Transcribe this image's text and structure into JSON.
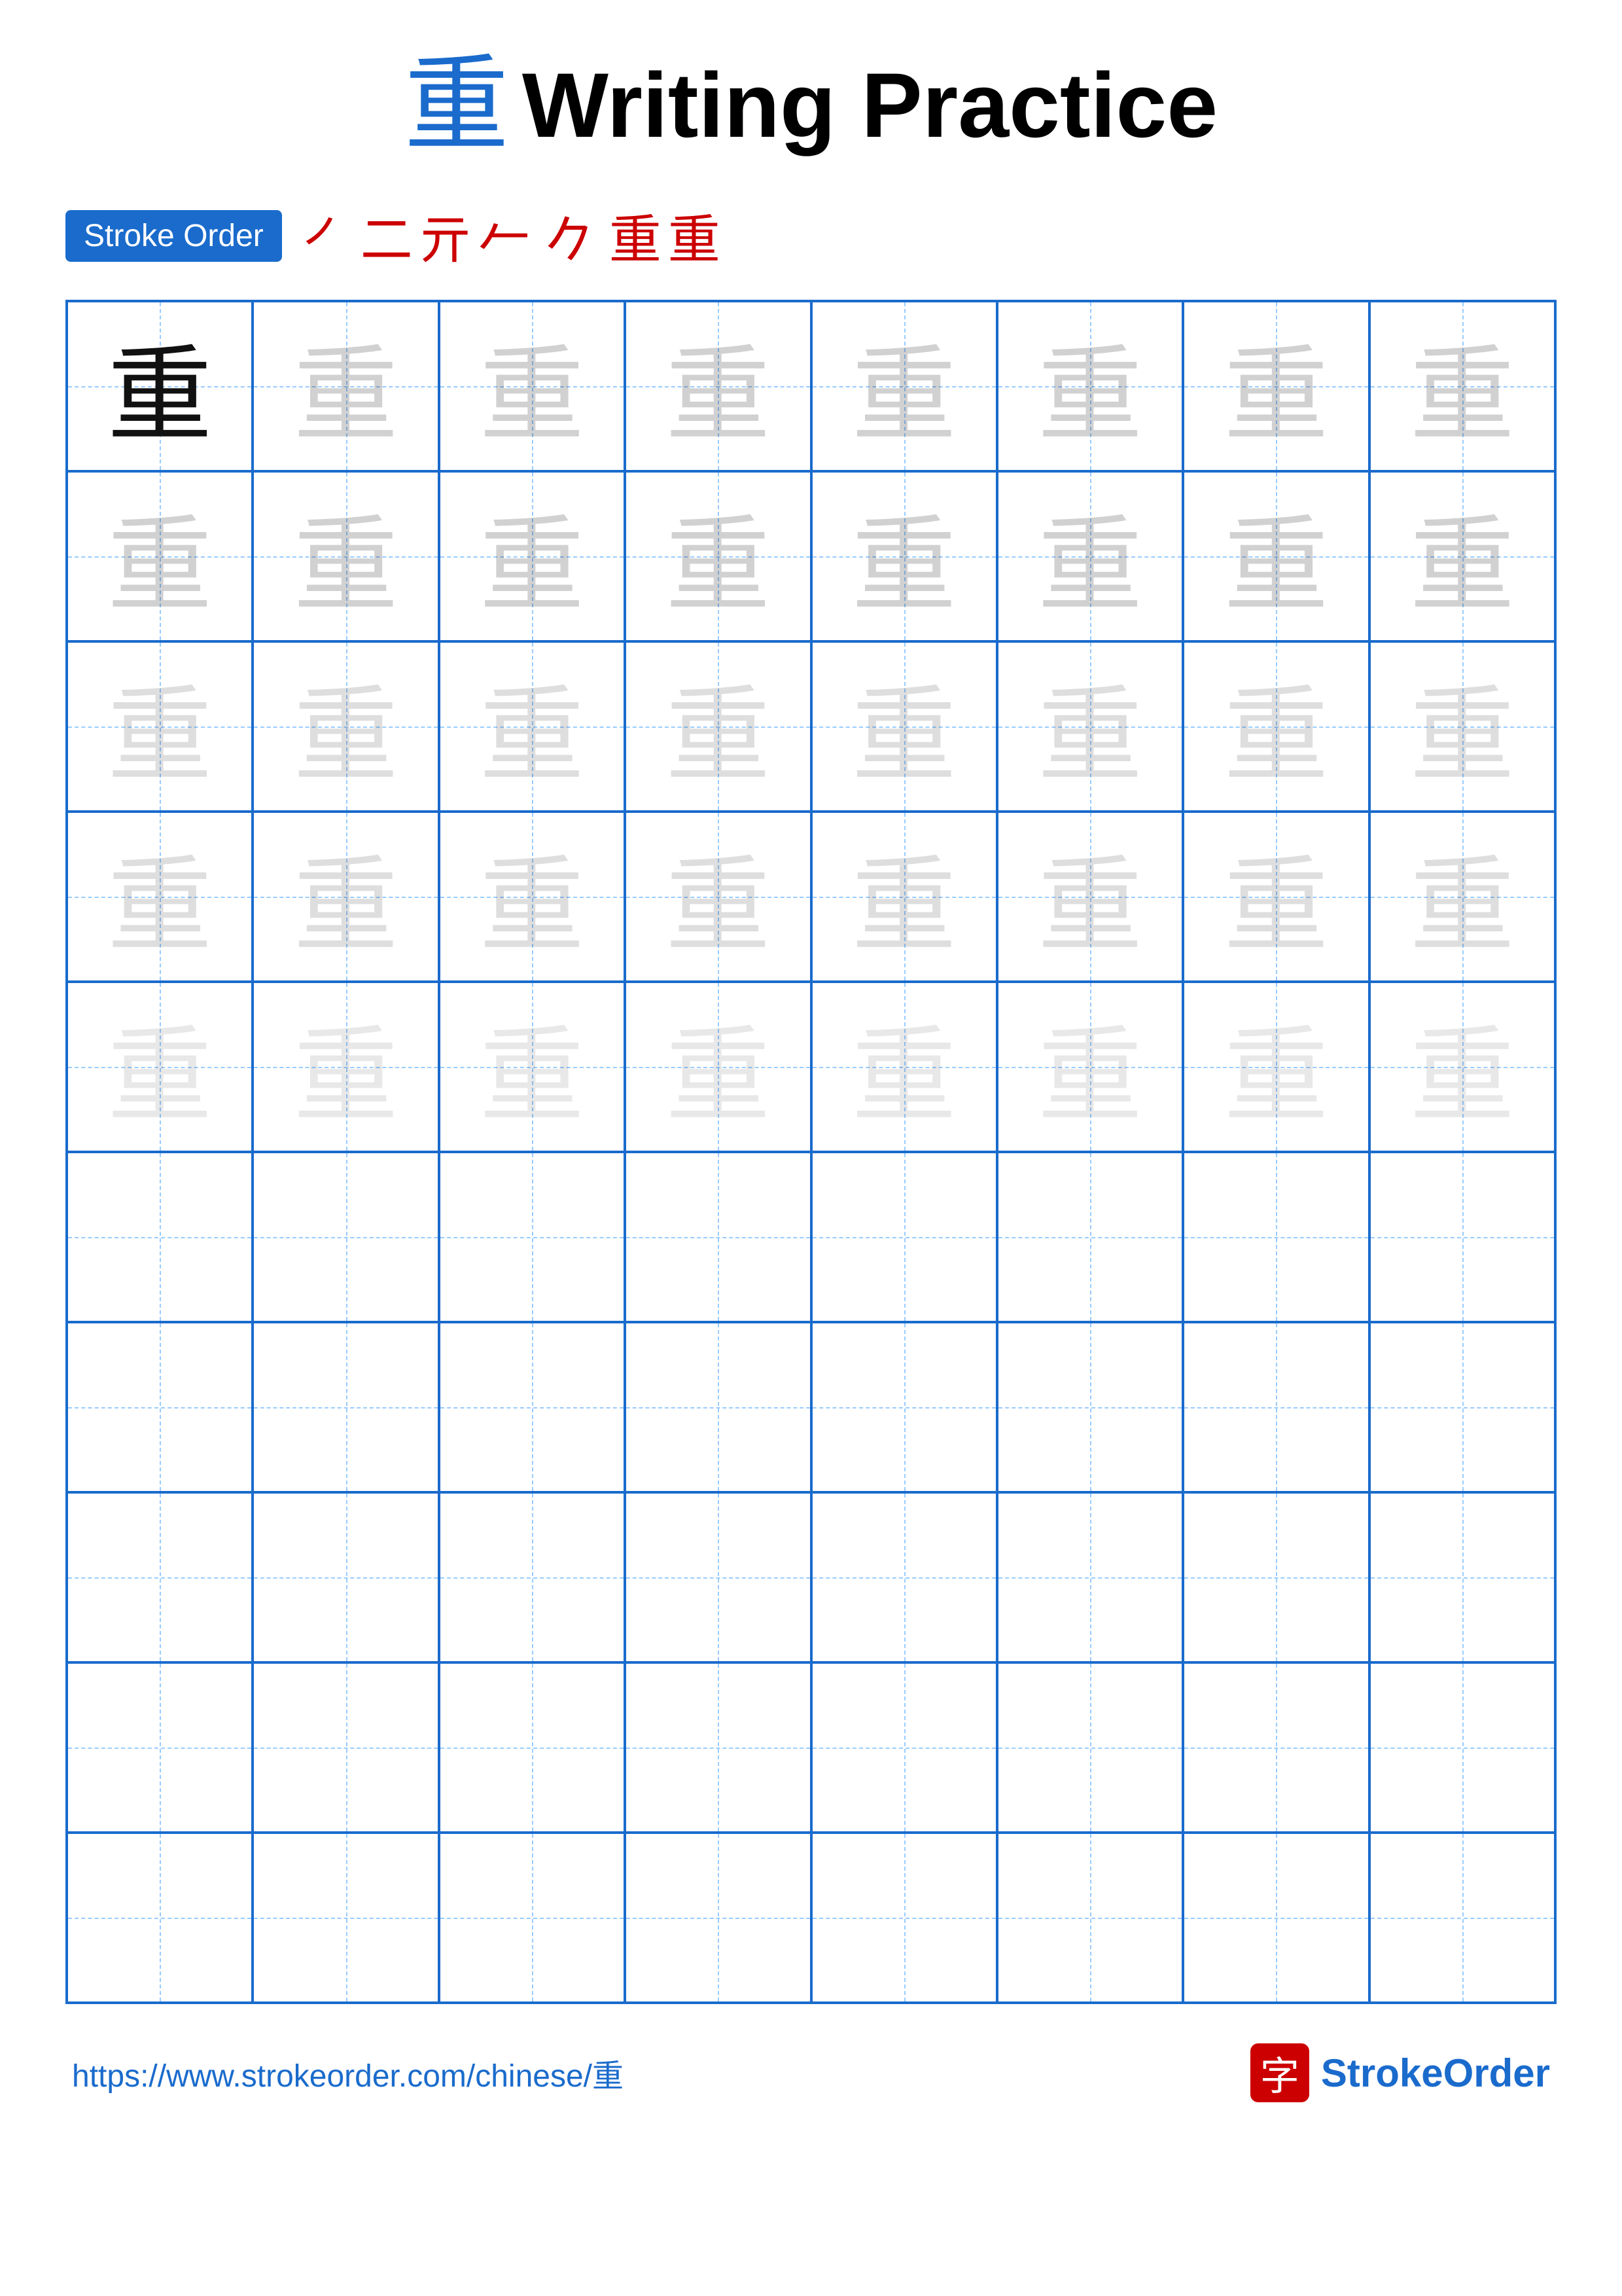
{
  "title": {
    "char": "重",
    "text": "Writing Practice"
  },
  "stroke_order": {
    "badge_label": "Stroke Order",
    "chars": [
      "㇒",
      "二",
      "亓",
      "𠂉",
      "𠂉",
      "𠂊",
      "𠂊",
      "重",
      "重"
    ]
  },
  "grid": {
    "cols": 8,
    "rows": 10,
    "char": "重",
    "row_styles": [
      [
        "dark",
        "light1",
        "light1",
        "light1",
        "light1",
        "light1",
        "light1",
        "light1"
      ],
      [
        "light1",
        "light1",
        "light1",
        "light1",
        "light1",
        "light1",
        "light1",
        "light1"
      ],
      [
        "light2",
        "light2",
        "light2",
        "light2",
        "light2",
        "light2",
        "light2",
        "light2"
      ],
      [
        "light2",
        "light2",
        "light2",
        "light2",
        "light2",
        "light2",
        "light2",
        "light2"
      ],
      [
        "light3",
        "light3",
        "light3",
        "light3",
        "light3",
        "light3",
        "light3",
        "light3"
      ],
      [
        "empty",
        "empty",
        "empty",
        "empty",
        "empty",
        "empty",
        "empty",
        "empty"
      ],
      [
        "empty",
        "empty",
        "empty",
        "empty",
        "empty",
        "empty",
        "empty",
        "empty"
      ],
      [
        "empty",
        "empty",
        "empty",
        "empty",
        "empty",
        "empty",
        "empty",
        "empty"
      ],
      [
        "empty",
        "empty",
        "empty",
        "empty",
        "empty",
        "empty",
        "empty",
        "empty"
      ],
      [
        "empty",
        "empty",
        "empty",
        "empty",
        "empty",
        "empty",
        "empty",
        "empty"
      ]
    ]
  },
  "footer": {
    "url": "https://www.strokeorder.com/chinese/重",
    "brand_char": "字",
    "brand_name_part1": "Stroke",
    "brand_name_part2": "Order"
  }
}
